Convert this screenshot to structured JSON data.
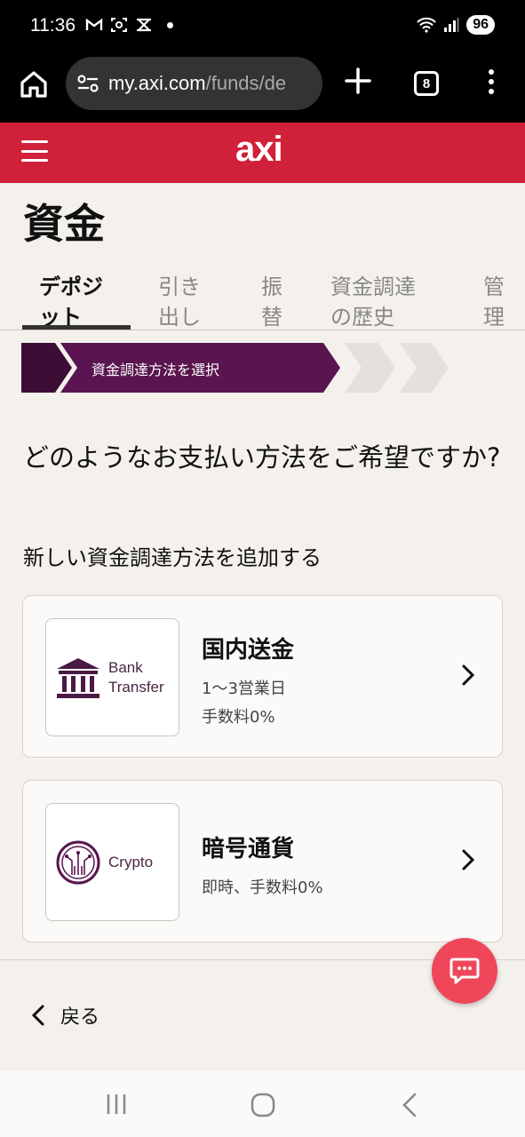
{
  "status_bar": {
    "time": "11:36",
    "battery": "96"
  },
  "browser": {
    "url_host": "my.axi.com",
    "url_path": "/funds/de",
    "tab_count": "8"
  },
  "app": {
    "logo": "axi"
  },
  "page": {
    "title": "資金"
  },
  "tabs": [
    {
      "line1": "デポジ",
      "line2": "ット",
      "active": true
    },
    {
      "line1": "引き",
      "line2": "出し",
      "active": false
    },
    {
      "line1": "振",
      "line2": "替",
      "active": false
    },
    {
      "line1": "資金調達",
      "line2": "の歴史",
      "active": false
    },
    {
      "line1": "管",
      "line2": "理",
      "active": false
    }
  ],
  "stepper": {
    "current_step": "資金調達方法を選択"
  },
  "content": {
    "question": "どのようなお支払い方法をご希望ですか?",
    "add_method_label": "新しい資金調達方法を追加する"
  },
  "methods": [
    {
      "logo_line1": "Bank",
      "logo_line2": "Transfer",
      "title": "国内送金",
      "detail1": "1〜3営業日",
      "detail2": "手数料0%"
    },
    {
      "logo_line1": "Crypto",
      "title": "暗号通貨",
      "detail1": "即時、手数料0%"
    }
  ],
  "footer": {
    "back_label": "戻る"
  },
  "colors": {
    "brand_red": "#d0203a",
    "brand_purple": "#5a1550",
    "chat_fab": "#f0465a"
  }
}
